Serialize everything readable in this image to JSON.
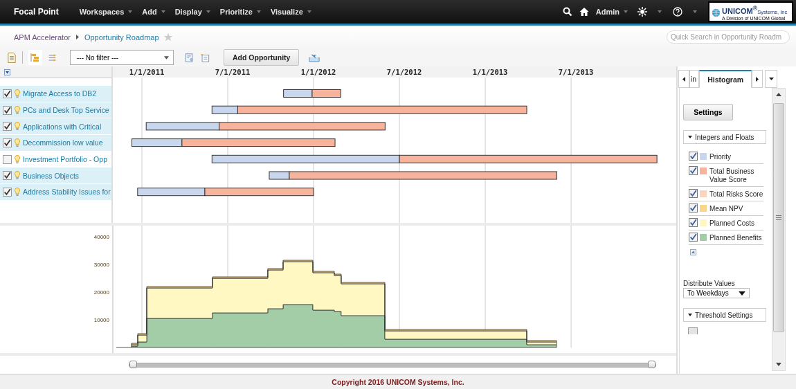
{
  "nav": {
    "brand": "Focal Point",
    "menus": [
      "Workspaces",
      "Add",
      "Display",
      "Prioritize",
      "Visualize"
    ],
    "user": "Admin"
  },
  "logo": {
    "name": "UNICOM$^{®}$",
    "suffix": "Systems, Inc",
    "tagline": "A Division of UNICOM Global"
  },
  "breadcrumb": [
    "APM Accelerator",
    "Opportunity Roadmap"
  ],
  "search": {
    "placeholder": "Quick Search in Opportunity Roadm"
  },
  "toolbar": {
    "filter": "--- No filter ---",
    "add_button": "Add Opportunity"
  },
  "rows": [
    {
      "name": "Migrate Access to DB2",
      "checked": true
    },
    {
      "name": "PCs and Desk Top Service",
      "checked": true
    },
    {
      "name": "Applications with Critical",
      "checked": true
    },
    {
      "name": "Decommission low value",
      "checked": true
    },
    {
      "name": "Investment Portfolio - Opp",
      "checked": false
    },
    {
      "name": "Business Objects",
      "checked": true
    },
    {
      "name": "Address Stability Issues for",
      "checked": true
    }
  ],
  "timeline": {
    "dates": [
      "1/1/2011",
      "7/1/2011",
      "1/1/2012",
      "7/1/2012",
      "1/1/2013",
      "7/1/2013"
    ]
  },
  "histogram": {
    "y_labels": [
      "40000",
      "30000",
      "20000",
      "10000"
    ]
  },
  "timeline_slider": {
    "level": 1
  },
  "panel": {
    "tabs": [
      {
        "label": "in",
        "selected": false
      },
      {
        "label": "Histogram",
        "selected": true
      }
    ],
    "settings_button": "Settings",
    "section": "Integers and Floats",
    "legend": [
      {
        "label": "Priority",
        "color": "#c9d7ee",
        "checked": true
      },
      {
        "label": "Total Business Value Score",
        "color": "#f7b39c",
        "checked": true
      },
      {
        "label": "Total Risks Score",
        "color": "#fcd5bd",
        "checked": true
      },
      {
        "label": "Mean NPV",
        "color": "#f9d68a",
        "checked": true
      },
      {
        "label": "Planned Costs",
        "color": "#fff6c2",
        "checked": true
      },
      {
        "label": "Planned Benefits",
        "color": "#a3cda6",
        "checked": true
      }
    ],
    "distribute_label": "Distribute Values",
    "distribute_value": "To Weekdays",
    "threshold_section": "Threshold Settings",
    "threshold_items": [
      {
        "checked": false
      }
    ]
  },
  "footer": "Copyright 2016 UNICOM Systems, Inc."
}
